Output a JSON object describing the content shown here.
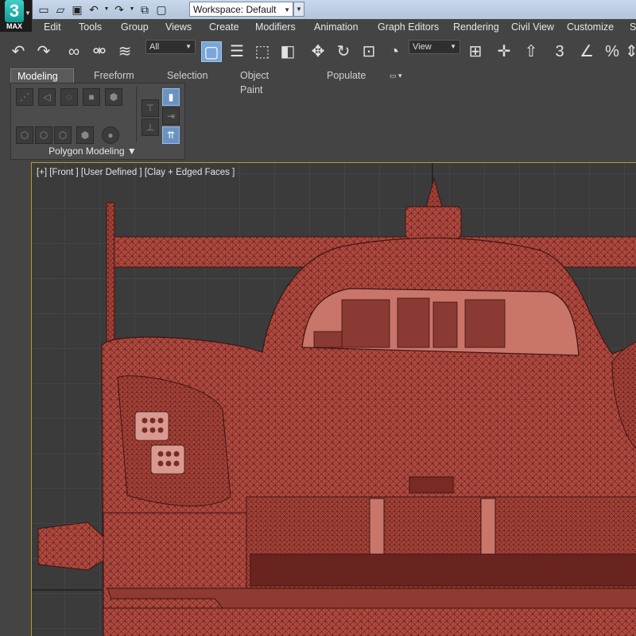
{
  "app": {
    "logo_text": "3",
    "logo_sub": "MAX"
  },
  "quick_access": {
    "workspace_value": "Workspace: Default",
    "icons": [
      "new-file-icon",
      "open-file-icon",
      "save-icon",
      "undo-icon",
      "redo-icon",
      "project-icon",
      "window-icon"
    ]
  },
  "menubar": {
    "items": [
      "Edit",
      "Tools",
      "Group",
      "Views",
      "Create",
      "Modifiers",
      "Animation",
      "Graph Editors",
      "Rendering",
      "Civil View",
      "Customize",
      "S"
    ]
  },
  "main_toolbar": {
    "selection_filter": "All",
    "ref_coord": "View",
    "snap_label": "3"
  },
  "ribbon": {
    "tabs": [
      "Modeling",
      "Freeform",
      "Selection",
      "Object Paint",
      "Populate"
    ],
    "active_tab": "Modeling",
    "panel_label": "Polygon Modeling"
  },
  "viewport": {
    "label": "[+] [Front ] [User Defined ] [Clay + Edged Faces ]",
    "border_color": "#b89a2a",
    "model_color": "#b24a40"
  }
}
